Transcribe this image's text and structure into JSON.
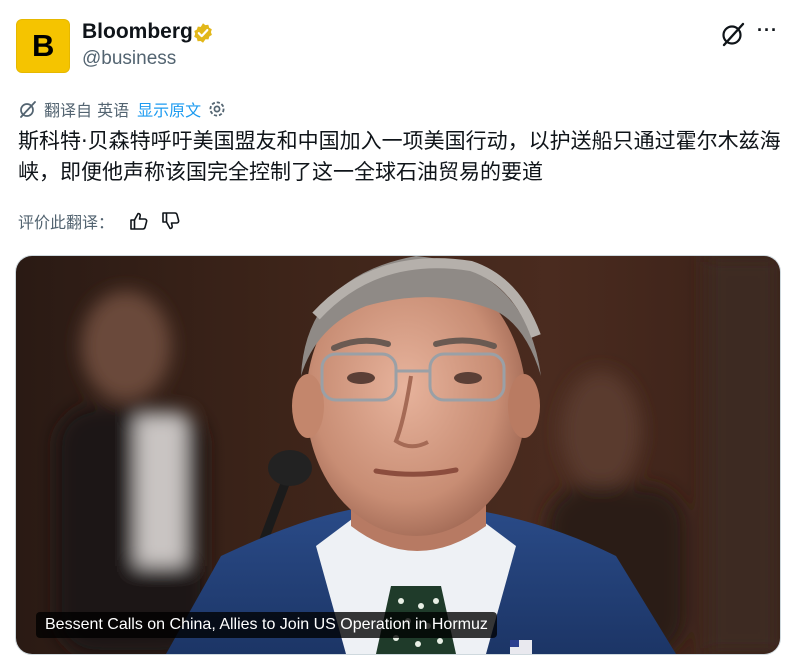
{
  "account": {
    "name": "Bloomberg",
    "handle": "@business",
    "avatar_letter": "B",
    "avatar_color": "#f5c400",
    "verified_badge": "gold-verified-badge-icon"
  },
  "header_actions": {
    "grok_icon": "grok-icon",
    "more_label": "···"
  },
  "translation": {
    "label": "翻译自 英语",
    "show_original": "显示原文",
    "settings_icon": "gear-icon"
  },
  "post": {
    "text": "斯科特·贝森特呼吁美国盟友和中国加入一项美国行动，以护送船只通过霍尔木兹海峡，即便他声称该国完全控制了这一全球石油贸易的要道"
  },
  "rating": {
    "label": "评价此翻译：",
    "thumbs_up_icon": "thumbs-up-icon",
    "thumbs_down_icon": "thumbs-down-icon"
  },
  "media": {
    "caption": "Bessent Calls on China, Allies to Join US Operation in Hormuz"
  },
  "colors": {
    "link_blue": "#1d9bf0",
    "muted_gray": "#536471",
    "text": "#0f1419"
  }
}
